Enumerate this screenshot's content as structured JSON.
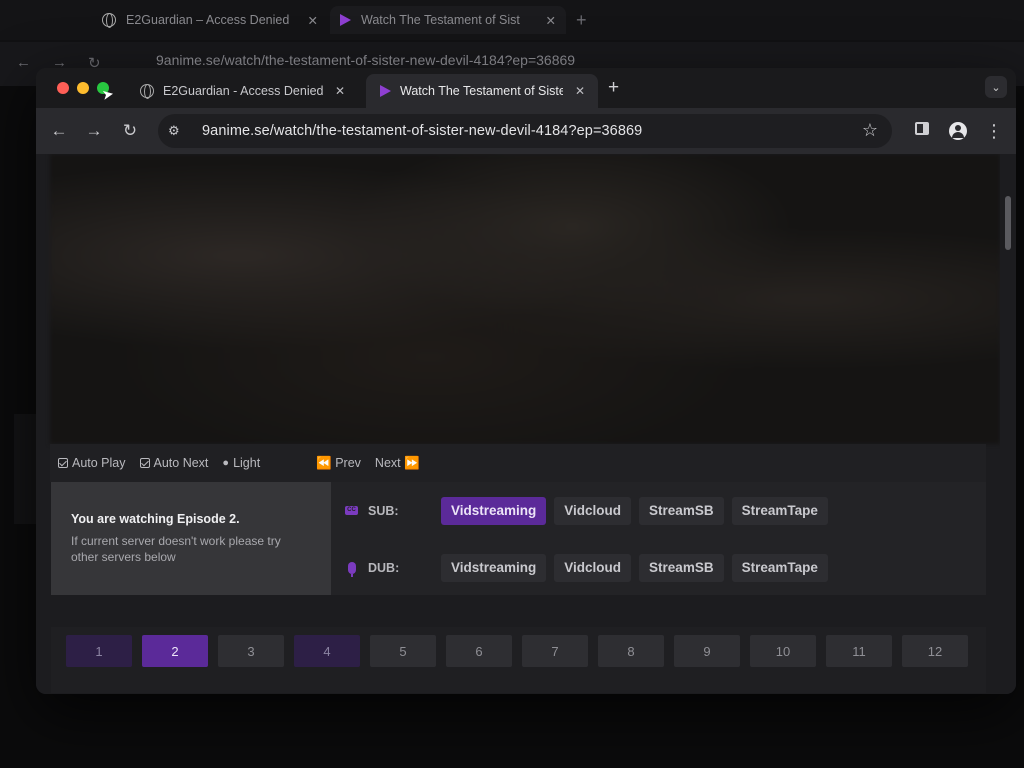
{
  "background_window": {
    "tabs": [
      {
        "title": "E2Guardian – Access Denied",
        "close": "✕"
      },
      {
        "title": "Watch The Testament of Sist",
        "close": "✕"
      }
    ],
    "new_tab": "+",
    "url": "9anime.se/watch/the-testament-of-sister-new-devil-4184?ep=36869"
  },
  "tabs": [
    {
      "title": "E2Guardian - Access Denied",
      "close": "✕",
      "icon": "globe-icon"
    },
    {
      "title": "Watch The Testament of Siste",
      "close": "✕",
      "icon": "play-icon"
    }
  ],
  "tab_strip": {
    "new_tab": "+",
    "tab_menu": "⌄"
  },
  "toolbar": {
    "back": "←",
    "forward": "→",
    "reload": "↻",
    "site_info": "⚙",
    "url": "9anime.se/watch/the-testament-of-sister-new-devil-4184?ep=36869",
    "bookmark": "☆",
    "menu": "⋮"
  },
  "controls": {
    "auto_play": "Auto Play",
    "auto_next": "Auto Next",
    "light": "Light",
    "prev": "⏪ Prev",
    "next": "Next ⏩"
  },
  "episode_info": {
    "title": "You are watching Episode 2.",
    "note": "If current server doesn't work please try other servers below"
  },
  "servers": {
    "sub": {
      "label": "SUB:",
      "options": [
        "Vidstreaming",
        "Vidcloud",
        "StreamSB",
        "StreamTape"
      ],
      "selected": "Vidstreaming"
    },
    "dub": {
      "label": "DUB:",
      "options": [
        "Vidstreaming",
        "Vidcloud",
        "StreamSB",
        "StreamTape"
      ]
    }
  },
  "episodes": {
    "list": [
      "1",
      "2",
      "3",
      "4",
      "5",
      "6",
      "7",
      "8",
      "9",
      "10",
      "11",
      "12"
    ],
    "current": "2",
    "watched": [
      "1",
      "4"
    ]
  },
  "colors": {
    "accent": "#5b2a99",
    "watched": "#2d1f46"
  }
}
